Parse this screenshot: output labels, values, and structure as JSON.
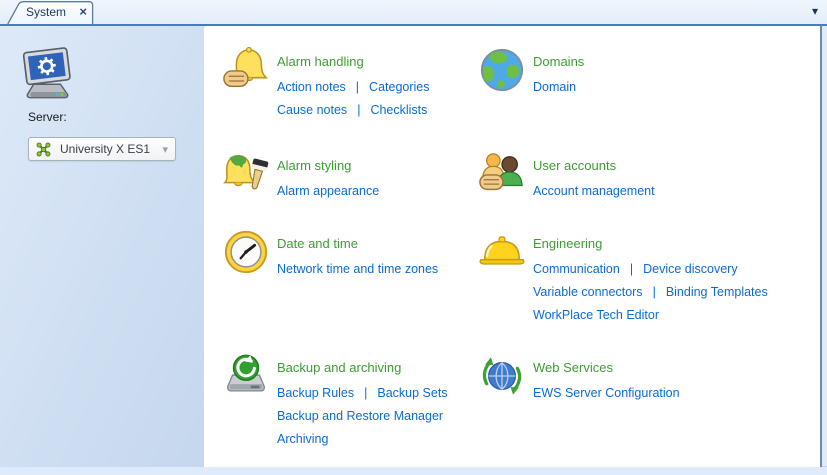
{
  "window": {
    "tab": {
      "label": "System",
      "close_glyph": "×"
    },
    "tab_overflow_glyph": "▾"
  },
  "sidebar": {
    "server_icon": "workstation-icon",
    "server_label": "Server:",
    "server_select": {
      "icon": "enterprise-server-icon",
      "value": "University X ES1",
      "arrow_glyph": "▾"
    }
  },
  "link_separator": "|",
  "sections": [
    {
      "title": "Alarm handling",
      "icon": "alarm-handling-icon",
      "link_rows": [
        [
          "Action notes",
          "Categories"
        ],
        [
          "Cause notes",
          "Checklists"
        ]
      ]
    },
    {
      "title": "Domains",
      "icon": "domains-icon",
      "link_rows": [
        [
          "Domain"
        ]
      ]
    },
    {
      "title": "Alarm styling",
      "icon": "alarm-styling-icon",
      "link_rows": [
        [
          "Alarm appearance"
        ]
      ]
    },
    {
      "title": "User accounts",
      "icon": "user-accounts-icon",
      "link_rows": [
        [
          "Account management"
        ]
      ]
    },
    {
      "title": "Date and time",
      "icon": "date-and-time-icon",
      "link_rows": [
        [
          "Network time and time zones"
        ]
      ]
    },
    {
      "title": "Engineering",
      "icon": "engineering-icon",
      "link_rows": [
        [
          "Communication",
          "Device discovery"
        ],
        [
          "Variable connectors",
          "Binding Templates"
        ],
        [
          "WorkPlace Tech Editor"
        ]
      ]
    },
    {
      "title": "Backup and archiving",
      "icon": "backup-and-archiving-icon",
      "link_rows": [
        [
          "Backup Rules",
          "Backup Sets"
        ],
        [
          "Backup and Restore Manager"
        ],
        [
          "Archiving"
        ]
      ]
    },
    {
      "title": "Web Services",
      "icon": "web-services-icon",
      "link_rows": [
        [
          "EWS Server Configuration"
        ]
      ]
    }
  ],
  "colors": {
    "section_title": "#3f9c35",
    "link": "#0b6bd5",
    "tab_border": "#5a7ba8",
    "tab_underline": "#4d7ab8",
    "frame": "#dfeafa"
  }
}
